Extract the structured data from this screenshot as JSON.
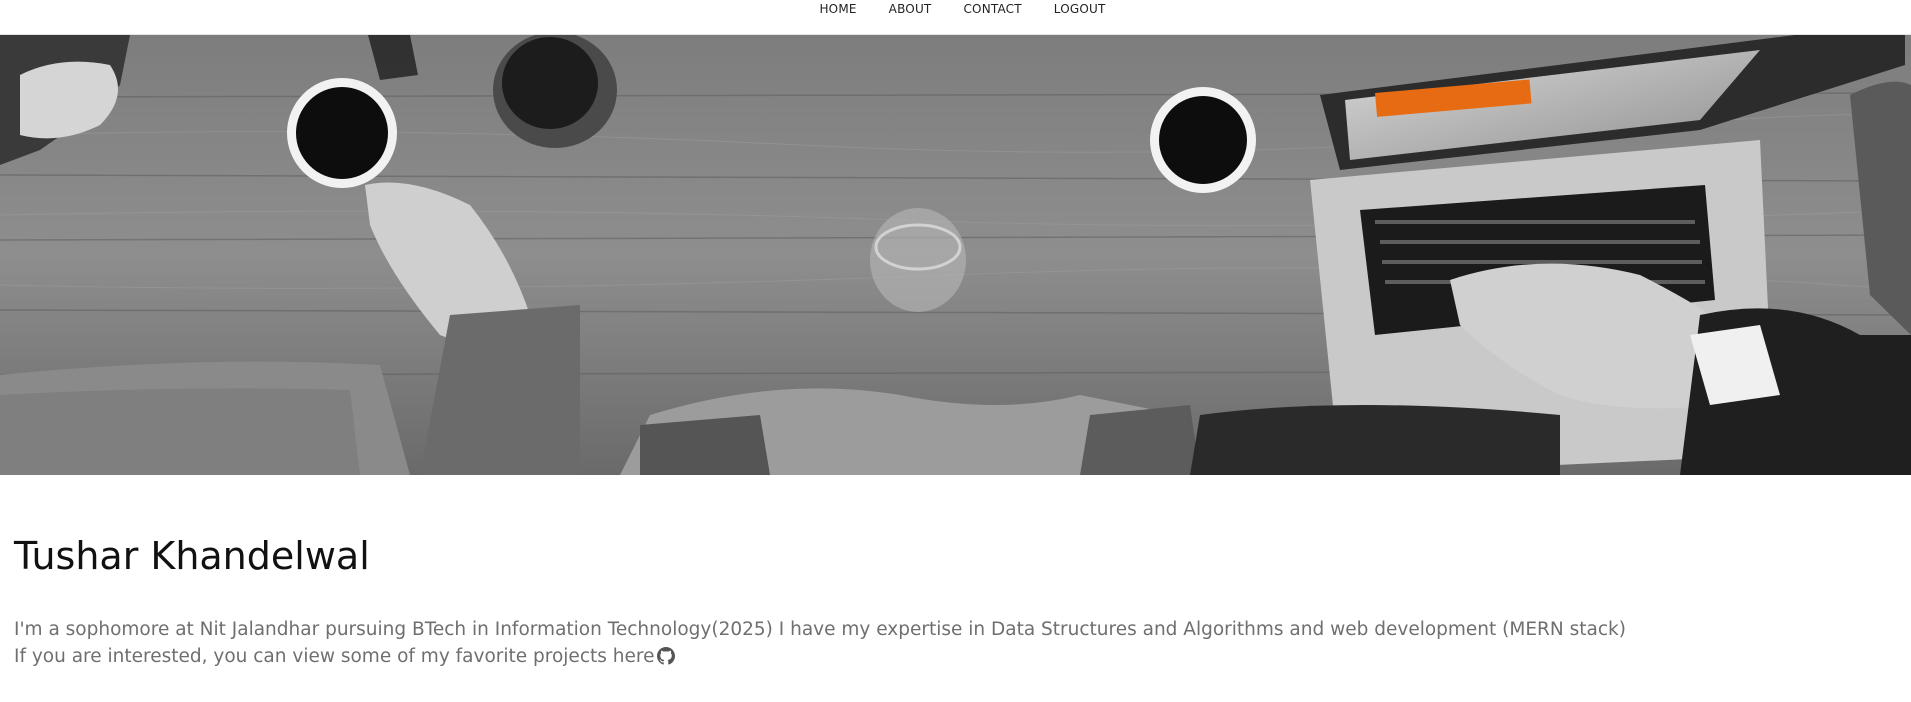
{
  "nav": {
    "items": [
      {
        "label": "HOME"
      },
      {
        "label": "ABOUT"
      },
      {
        "label": "CONTACT"
      },
      {
        "label": "LOGOUT"
      }
    ]
  },
  "hero": {
    "image_subject": "black-and-white photo of people at a wooden table with coffee cups, a glass of water and a laptop"
  },
  "profile": {
    "name": "Tushar Khandelwal",
    "bio_line1": "I'm a sophomore at Nit Jalandhar pursuing BTech in Information Technology(2025) I have my expertise in Data Structures and Algorithms and web development (MERN stack)",
    "bio_line2": "If you are interested, you can view some of my favorite projects here",
    "projects_icon": "github-icon"
  },
  "colors": {
    "text_primary": "#111111",
    "text_secondary": "#6f6f6f",
    "nav_text": "#222222",
    "background": "#ffffff"
  }
}
